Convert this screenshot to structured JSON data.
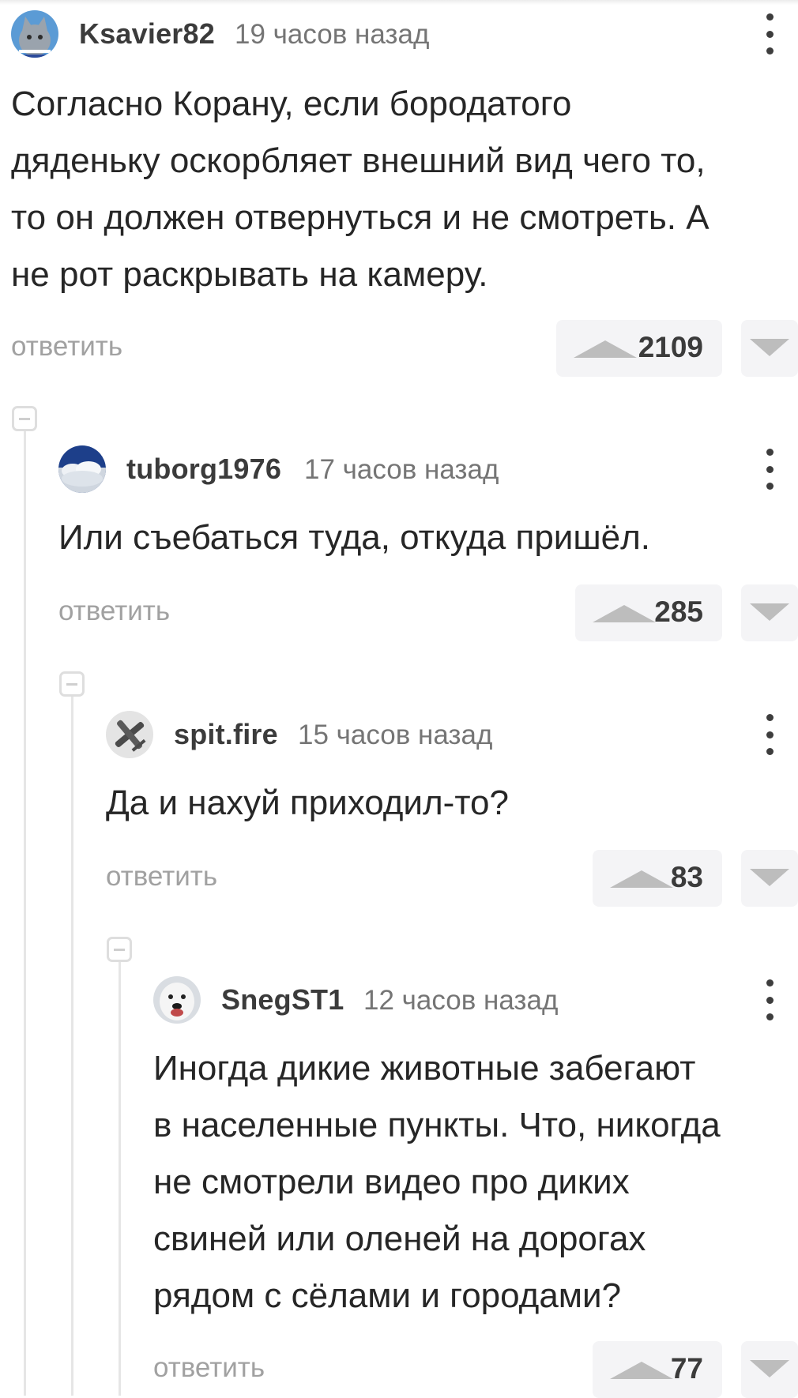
{
  "comments": [
    {
      "author": "Ksavier82",
      "time": "19 часов назад",
      "lines": [
        "Согласно Корану, если бородатого",
        "дяденьку оскорбляет внешний вид чего то,",
        "то он должен отвернуться и не смотреть. А",
        "не рот раскрывать на камеру."
      ],
      "reply_label": "ответить",
      "rating": "2109",
      "avatar_icon": "cat-avatar-icon"
    },
    {
      "author": "tuborg1976",
      "time": "17 часов назад",
      "lines": [
        "Или съебаться туда, откуда пришёл."
      ],
      "reply_label": "ответить",
      "rating": "285",
      "avatar_icon": "cloud-sky-avatar-icon"
    },
    {
      "author": "spit.fire",
      "time": "15 часов назад",
      "lines": [
        "Да и нахуй приходил-то?"
      ],
      "reply_label": "ответить",
      "rating": "83",
      "avatar_icon": "airplane-avatar-icon"
    },
    {
      "author": "SnegST1",
      "time": "12 часов назад",
      "lines": [
        "Иногда дикие животные забегают",
        "в населенные пункты. Что, никогда",
        "не смотрели видео про диких",
        "свиней или оленей на дорогах",
        "рядом с сёлами и городами?"
      ],
      "reply_label": "ответить",
      "rating": "77",
      "avatar_icon": "dog-avatar-icon"
    }
  ],
  "icons": {
    "vote_up": "triangle-up-icon",
    "vote_down": "triangle-down-icon",
    "menu": "vertical-dots-icon",
    "collapse": "minus-box-icon"
  },
  "colors": {
    "author": "#3b3b3b",
    "timestamp": "#757575",
    "reply": "#a1a1a1",
    "vote_bg": "#f4f4f6",
    "vote_arrow": "#bdbdbd",
    "thread_line": "#e6e6e6"
  }
}
